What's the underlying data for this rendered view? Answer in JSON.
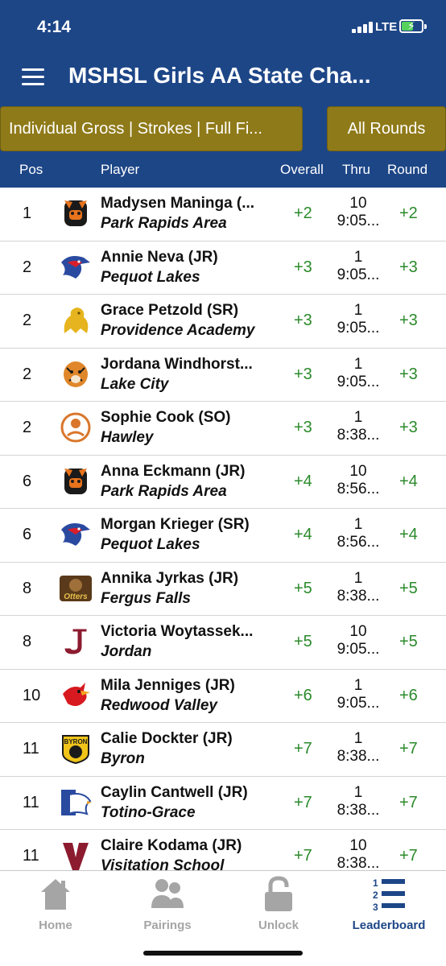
{
  "status": {
    "time": "4:14",
    "network": "LTE"
  },
  "app": {
    "title": "MSHSL Girls AA State Cha..."
  },
  "filters": {
    "left": "Individual Gross | Strokes | Full Fi...",
    "right": "All Rounds"
  },
  "columns": {
    "pos": "Pos",
    "player": "Player",
    "overall": "Overall",
    "thru": "Thru",
    "round": "Round"
  },
  "rows": [
    {
      "pos": "1",
      "name": "Madysen Maninga (...",
      "school": "Park Rapids Area",
      "overall": "+2",
      "thru": "10",
      "time": "9:05...",
      "round": "+2",
      "logo": "panther-icon"
    },
    {
      "pos": "2",
      "name": "Annie Neva (JR)",
      "school": "Pequot Lakes",
      "overall": "+3",
      "thru": "1",
      "time": "9:05...",
      "round": "+3",
      "logo": "patriot-icon"
    },
    {
      "pos": "2",
      "name": "Grace Petzold (SR)",
      "school": "Providence Academy",
      "overall": "+3",
      "thru": "1",
      "time": "9:05...",
      "round": "+3",
      "logo": "lion-icon"
    },
    {
      "pos": "2",
      "name": "Jordana Windhorst...",
      "school": "Lake City",
      "overall": "+3",
      "thru": "1",
      "time": "9:05...",
      "round": "+3",
      "logo": "tiger-icon"
    },
    {
      "pos": "2",
      "name": "Sophie  Cook (SO)",
      "school": "Hawley",
      "overall": "+3",
      "thru": "1",
      "time": "8:38...",
      "round": "+3",
      "logo": "nuggets-icon"
    },
    {
      "pos": "6",
      "name": "Anna Eckmann (JR)",
      "school": "Park Rapids Area",
      "overall": "+4",
      "thru": "10",
      "time": "8:56...",
      "round": "+4",
      "logo": "panther-icon"
    },
    {
      "pos": "6",
      "name": "Morgan Krieger (SR)",
      "school": "Pequot Lakes",
      "overall": "+4",
      "thru": "1",
      "time": "8:56...",
      "round": "+4",
      "logo": "patriot-icon"
    },
    {
      "pos": "8",
      "name": "Annika Jyrkas (JR)",
      "school": "Fergus Falls",
      "overall": "+5",
      "thru": "1",
      "time": "8:38...",
      "round": "+5",
      "logo": "otters-icon"
    },
    {
      "pos": "8",
      "name": "Victoria Woytassek...",
      "school": "Jordan",
      "overall": "+5",
      "thru": "10",
      "time": "9:05...",
      "round": "+5",
      "logo": "j-letter-icon"
    },
    {
      "pos": "10",
      "name": "Mila Jenniges (JR)",
      "school": "Redwood Valley",
      "overall": "+6",
      "thru": "1",
      "time": "9:05...",
      "round": "+6",
      "logo": "cardinal-icon"
    },
    {
      "pos": "11",
      "name": "Calie  Dockter (JR)",
      "school": "Byron",
      "overall": "+7",
      "thru": "1",
      "time": "8:38...",
      "round": "+7",
      "logo": "bear-icon"
    },
    {
      "pos": "11",
      "name": "Caylin Cantwell (JR)",
      "school": "Totino-Grace",
      "overall": "+7",
      "thru": "1",
      "time": "8:38...",
      "round": "+7",
      "logo": "eagle-icon"
    },
    {
      "pos": "11",
      "name": "Claire Kodama (JR)",
      "school": "Visitation School",
      "overall": "+7",
      "thru": "10",
      "time": "8:38...",
      "round": "+7",
      "logo": "v-letter-icon"
    }
  ],
  "tabs": [
    {
      "label": "Home",
      "icon": "home-icon"
    },
    {
      "label": "Pairings",
      "icon": "people-icon"
    },
    {
      "label": "Unlock",
      "icon": "lock-icon"
    },
    {
      "label": "Leaderboard",
      "icon": "leaderboard-icon"
    }
  ],
  "colors": {
    "header": "#1d4687",
    "filter": "#8f7a19",
    "positive": "#2b8a2b",
    "active_tab": "#1d4687"
  }
}
